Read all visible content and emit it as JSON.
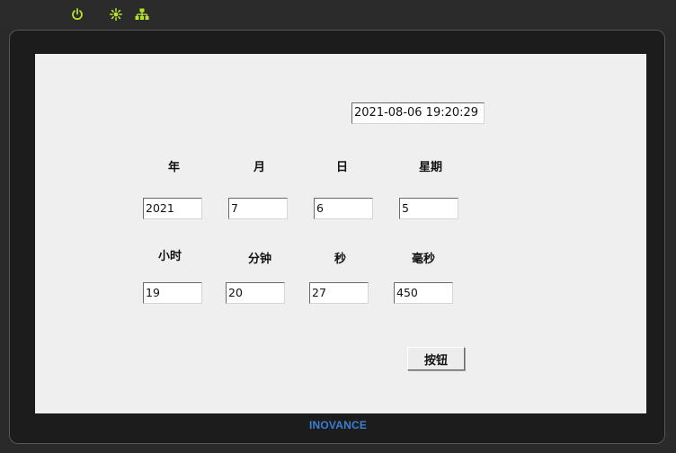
{
  "status_icons": [
    "power-icon",
    "sun-icon",
    "network-icon"
  ],
  "colors": {
    "status_icon": "#b7e42a",
    "brand": "#3b7fd4",
    "screen_bg": "#efefef"
  },
  "datetime": "2021-08-06 19:20:29",
  "labels": {
    "year": "年",
    "month": "月",
    "day": "日",
    "weekday": "星期",
    "hour": "小时",
    "minute": "分钟",
    "second": "秒",
    "millisecond": "毫秒"
  },
  "fields": {
    "year": "2021",
    "month": "7",
    "day": "6",
    "weekday": "5",
    "hour": "19",
    "minute": "20",
    "second": "27",
    "millisecond": "450"
  },
  "button_label": "按钮",
  "brand": "INOVANCE"
}
